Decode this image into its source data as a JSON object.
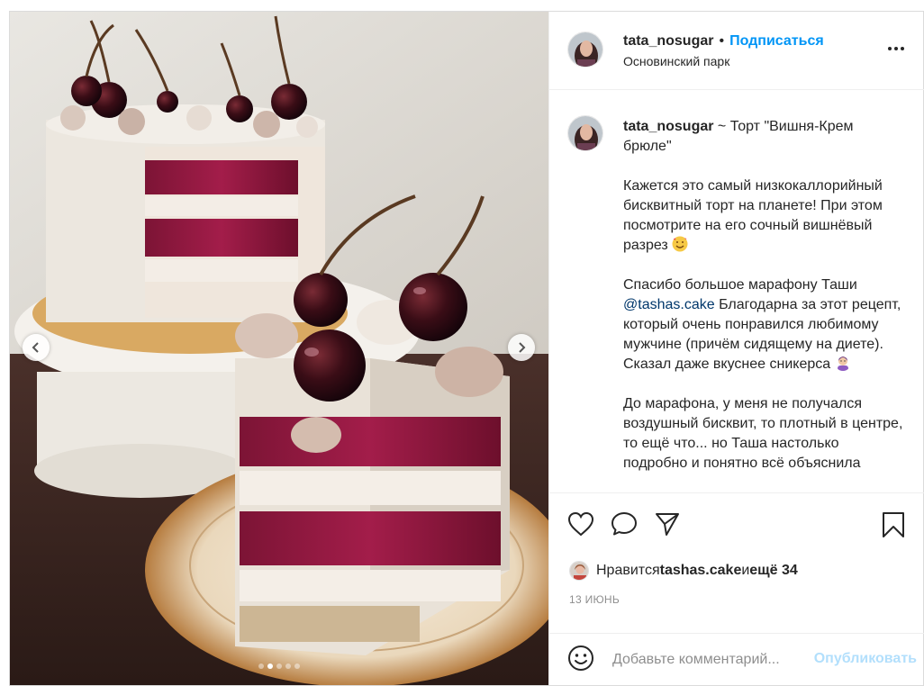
{
  "post": {
    "author": "tata_nosugar",
    "follow_label": "Подписаться",
    "location": "Основинский парк",
    "bullet": "•",
    "images_count": 5,
    "current_image": 2
  },
  "caption": {
    "title_suffix": " ~ Торт \"Вишня-Крем брюле\"",
    "p1": "Кажется это самый низкокаллорийный бисквитный торт на планете! При этом посмотрите на его сочный вишнёвый разрез",
    "p2_before": "Спасибо большое марафону Таши ",
    "p2_tag": "@tashas.cake",
    "p2_after": " Благодарна за этот рецепт, который очень понравился любимому мужчине (причём сидящему на диете). Сказал даже вкуснее сникерса",
    "p3": "До марафона, у меня не получался воздушный бисквит, то плотный в центре, то ещё что... но Таша настолько подробно и понятно всё объяснила"
  },
  "likes": {
    "prefix": "Нравится ",
    "user": "tashas.cake",
    "middle": " и ",
    "others": "ещё 34"
  },
  "date": "13 июнь",
  "comment": {
    "placeholder": "Добавьте комментарий...",
    "publish_label": "Опубликовать"
  },
  "colors": {
    "link_blue": "#0095f6",
    "publish_disabled": "#b2dffc",
    "muted": "#8e8e8e",
    "tag": "#00376b"
  },
  "icons": {
    "more": "more-horizontal-icon",
    "like": "heart-icon",
    "comment": "comment-icon",
    "share": "paper-plane-icon",
    "save": "bookmark-icon",
    "emoji": "smiley-icon",
    "prev": "chevron-left-icon",
    "next": "chevron-right-icon"
  }
}
